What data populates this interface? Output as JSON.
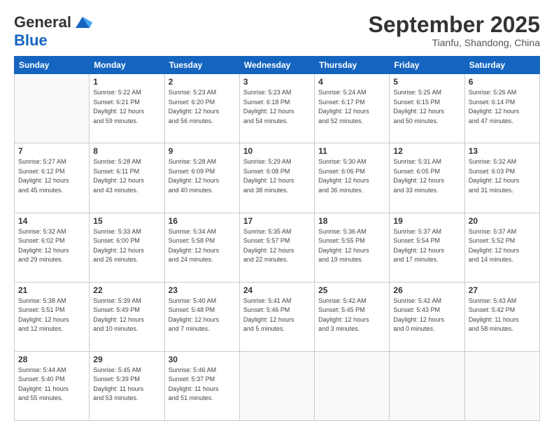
{
  "logo": {
    "line1": "General",
    "line2": "Blue"
  },
  "title": "September 2025",
  "subtitle": "Tianfu, Shandong, China",
  "days_of_week": [
    "Sunday",
    "Monday",
    "Tuesday",
    "Wednesday",
    "Thursday",
    "Friday",
    "Saturday"
  ],
  "weeks": [
    [
      {
        "day": "",
        "info": ""
      },
      {
        "day": "1",
        "info": "Sunrise: 5:22 AM\nSunset: 6:21 PM\nDaylight: 12 hours\nand 59 minutes."
      },
      {
        "day": "2",
        "info": "Sunrise: 5:23 AM\nSunset: 6:20 PM\nDaylight: 12 hours\nand 56 minutes."
      },
      {
        "day": "3",
        "info": "Sunrise: 5:23 AM\nSunset: 6:18 PM\nDaylight: 12 hours\nand 54 minutes."
      },
      {
        "day": "4",
        "info": "Sunrise: 5:24 AM\nSunset: 6:17 PM\nDaylight: 12 hours\nand 52 minutes."
      },
      {
        "day": "5",
        "info": "Sunrise: 5:25 AM\nSunset: 6:15 PM\nDaylight: 12 hours\nand 50 minutes."
      },
      {
        "day": "6",
        "info": "Sunrise: 5:26 AM\nSunset: 6:14 PM\nDaylight: 12 hours\nand 47 minutes."
      }
    ],
    [
      {
        "day": "7",
        "info": "Sunrise: 5:27 AM\nSunset: 6:12 PM\nDaylight: 12 hours\nand 45 minutes."
      },
      {
        "day": "8",
        "info": "Sunrise: 5:28 AM\nSunset: 6:11 PM\nDaylight: 12 hours\nand 43 minutes."
      },
      {
        "day": "9",
        "info": "Sunrise: 5:28 AM\nSunset: 6:09 PM\nDaylight: 12 hours\nand 40 minutes."
      },
      {
        "day": "10",
        "info": "Sunrise: 5:29 AM\nSunset: 6:08 PM\nDaylight: 12 hours\nand 38 minutes."
      },
      {
        "day": "11",
        "info": "Sunrise: 5:30 AM\nSunset: 6:06 PM\nDaylight: 12 hours\nand 36 minutes."
      },
      {
        "day": "12",
        "info": "Sunrise: 5:31 AM\nSunset: 6:05 PM\nDaylight: 12 hours\nand 33 minutes."
      },
      {
        "day": "13",
        "info": "Sunrise: 5:32 AM\nSunset: 6:03 PM\nDaylight: 12 hours\nand 31 minutes."
      }
    ],
    [
      {
        "day": "14",
        "info": "Sunrise: 5:32 AM\nSunset: 6:02 PM\nDaylight: 12 hours\nand 29 minutes."
      },
      {
        "day": "15",
        "info": "Sunrise: 5:33 AM\nSunset: 6:00 PM\nDaylight: 12 hours\nand 26 minutes."
      },
      {
        "day": "16",
        "info": "Sunrise: 5:34 AM\nSunset: 5:58 PM\nDaylight: 12 hours\nand 24 minutes."
      },
      {
        "day": "17",
        "info": "Sunrise: 5:35 AM\nSunset: 5:57 PM\nDaylight: 12 hours\nand 22 minutes."
      },
      {
        "day": "18",
        "info": "Sunrise: 5:36 AM\nSunset: 5:55 PM\nDaylight: 12 hours\nand 19 minutes."
      },
      {
        "day": "19",
        "info": "Sunrise: 5:37 AM\nSunset: 5:54 PM\nDaylight: 12 hours\nand 17 minutes."
      },
      {
        "day": "20",
        "info": "Sunrise: 5:37 AM\nSunset: 5:52 PM\nDaylight: 12 hours\nand 14 minutes."
      }
    ],
    [
      {
        "day": "21",
        "info": "Sunrise: 5:38 AM\nSunset: 5:51 PM\nDaylight: 12 hours\nand 12 minutes."
      },
      {
        "day": "22",
        "info": "Sunrise: 5:39 AM\nSunset: 5:49 PM\nDaylight: 12 hours\nand 10 minutes."
      },
      {
        "day": "23",
        "info": "Sunrise: 5:40 AM\nSunset: 5:48 PM\nDaylight: 12 hours\nand 7 minutes."
      },
      {
        "day": "24",
        "info": "Sunrise: 5:41 AM\nSunset: 5:46 PM\nDaylight: 12 hours\nand 5 minutes."
      },
      {
        "day": "25",
        "info": "Sunrise: 5:42 AM\nSunset: 5:45 PM\nDaylight: 12 hours\nand 3 minutes."
      },
      {
        "day": "26",
        "info": "Sunrise: 5:42 AM\nSunset: 5:43 PM\nDaylight: 12 hours\nand 0 minutes."
      },
      {
        "day": "27",
        "info": "Sunrise: 5:43 AM\nSunset: 5:42 PM\nDaylight: 11 hours\nand 58 minutes."
      }
    ],
    [
      {
        "day": "28",
        "info": "Sunrise: 5:44 AM\nSunset: 5:40 PM\nDaylight: 11 hours\nand 55 minutes."
      },
      {
        "day": "29",
        "info": "Sunrise: 5:45 AM\nSunset: 5:39 PM\nDaylight: 11 hours\nand 53 minutes."
      },
      {
        "day": "30",
        "info": "Sunrise: 5:46 AM\nSunset: 5:37 PM\nDaylight: 11 hours\nand 51 minutes."
      },
      {
        "day": "",
        "info": ""
      },
      {
        "day": "",
        "info": ""
      },
      {
        "day": "",
        "info": ""
      },
      {
        "day": "",
        "info": ""
      }
    ]
  ]
}
